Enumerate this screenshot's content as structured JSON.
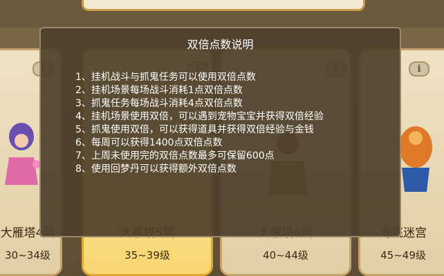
{
  "dialog": {
    "title": "双倍点数说明",
    "items": [
      "1、挂机战斗与抓鬼任务可以使用双倍点数",
      "2、挂机场景每场战斗消耗1点双倍点数",
      "3、抓鬼任务每场战斗消耗4点双倍点数",
      "4、挂机场景使用双倍，可以遇到宠物宝宝并获得双倍经验",
      "5、抓鬼使用双倍，可以获得道具并获得双倍经验与金钱",
      "6、每周可以获得1400点双倍点数",
      "7、上周未使用完的双倍点数最多可保留600点",
      "8、使用回梦丹可以获得额外双倍点数"
    ]
  },
  "cards": [
    {
      "name": "大雁塔4层",
      "level": "30~34级",
      "selected": false
    },
    {
      "name": "大雁塔5层",
      "level": "35~39级",
      "selected": true
    },
    {
      "name": "大雁塔6层",
      "level": "40~44级",
      "selected": false
    },
    {
      "name": "海底迷宫",
      "level": "45~49级",
      "selected": false
    }
  ],
  "colors": {
    "dialog_bg": "#4e402b",
    "card_bg": "#efe2c4",
    "selected_card": "#f7d772"
  }
}
